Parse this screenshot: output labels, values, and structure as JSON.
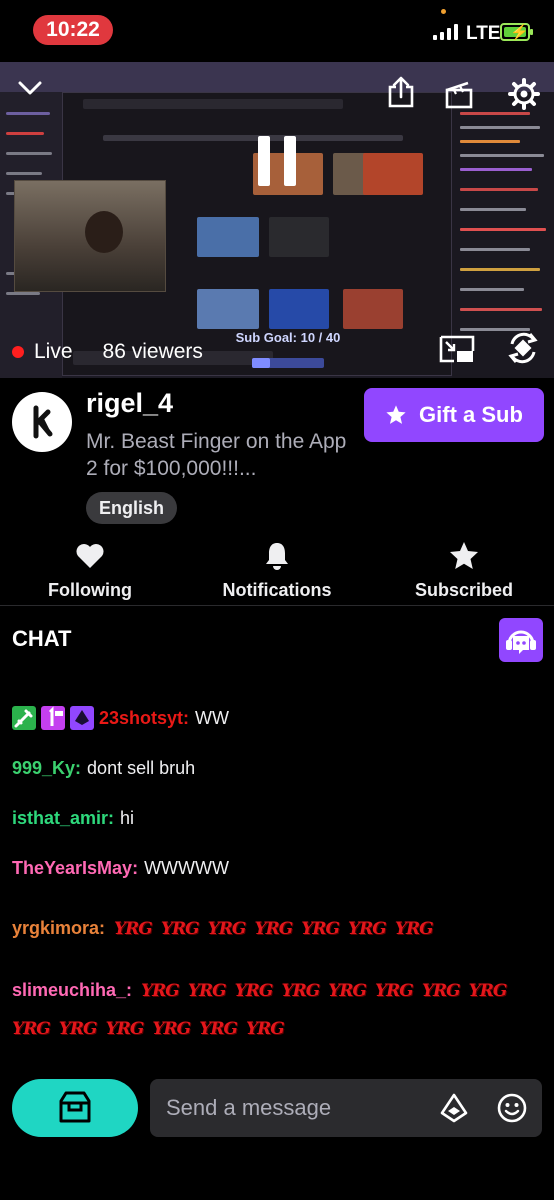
{
  "status_bar": {
    "time": "10:22",
    "network": "LTE",
    "colors": {
      "time_pill": "#e0383e",
      "battery": "#5fd13a"
    }
  },
  "player": {
    "live_label": "Live",
    "viewers": "86 viewers",
    "sub_goal": "Sub Goal: 10 / 40",
    "sub_goal_progress": 0.25,
    "icons": [
      "chevron-down-icon",
      "share-icon",
      "clip-icon",
      "settings-gear-icon",
      "pause-icon",
      "picture-in-picture-icon",
      "rotate-icon"
    ]
  },
  "channel": {
    "name": "rigel_4",
    "title": "Mr. Beast Finger on the App 2 for $100,000!!!...",
    "language": "English",
    "gift_label": "Gift a Sub"
  },
  "actions": [
    {
      "label": "Following",
      "icon": "heart-icon"
    },
    {
      "label": "Notifications",
      "icon": "bell-icon"
    },
    {
      "label": "Subscribed",
      "icon": "star-icon"
    }
  ],
  "chat": {
    "header": "CHAT",
    "messages": [
      {
        "user": "23shotsyt:",
        "text": "WW",
        "color": "#e91916",
        "badges": [
          "sword-badge",
          "first-badge",
          "bits-badge"
        ]
      },
      {
        "user": "999_Ky:",
        "text": "dont sell bruh",
        "color": "#3bd16f"
      },
      {
        "user": "isthat_amir:",
        "text": "hi",
        "color": "#2ed87c"
      },
      {
        "user": "TheYearIsMay:",
        "text": "WWWWW",
        "color": "#ff69b4"
      },
      {
        "user": "yrgkimora:",
        "text": "",
        "color": "#e8823a",
        "emotes": [
          "YRG",
          "YRG",
          "YRG",
          "YRG",
          "YRG",
          "YRG",
          "YRG"
        ]
      },
      {
        "user": "slimeuchiha_:",
        "text": "",
        "color": "#ff69b4",
        "emotes": [
          "YRG",
          "YRG",
          "YRG",
          "YRG",
          "YRG",
          "YRG",
          "YRG",
          "YRG",
          "YRG",
          "YRG",
          "YRG",
          "YRG",
          "YRG",
          "YRG"
        ]
      }
    ],
    "input_placeholder": "Send a message"
  },
  "accent": {
    "purple": "#9147ff",
    "teal": "#1fd6c3"
  }
}
